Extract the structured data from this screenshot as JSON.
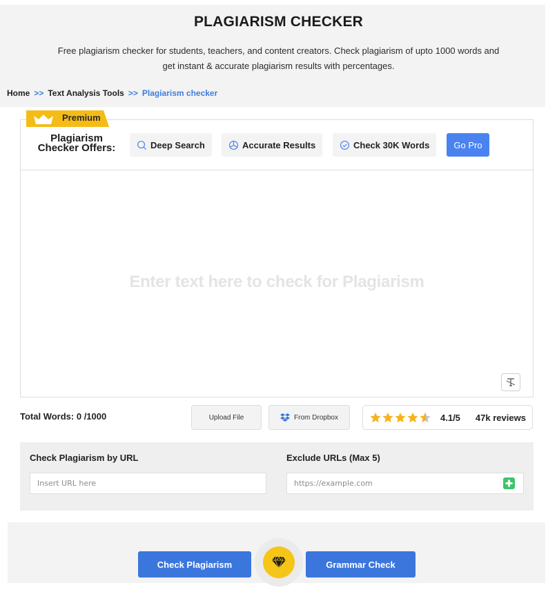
{
  "header": {
    "title": "PLAGIARISM CHECKER",
    "subtitle_line1": "Free plagiarism checker for students, teachers, and content creators. Check plagiarism of upto 1000 words and",
    "subtitle_line2": "get instant & accurate plagiarism results with percentages."
  },
  "breadcrumb": {
    "items": [
      "Home",
      "Text Analysis Tools",
      "Plagiarism checker"
    ],
    "separator": ">>"
  },
  "premium": {
    "badge_label": "Premium",
    "offers_title_line1": "Plagiarism",
    "offers_title_line2": "Checker Offers:",
    "features": [
      {
        "label": "Deep Search",
        "icon": "search-icon"
      },
      {
        "label": "Accurate Results",
        "icon": "pie-chart-icon"
      },
      {
        "label": "Check 30K Words",
        "icon": "check-circle-icon"
      }
    ],
    "go_pro_label": "Go Pro"
  },
  "editor": {
    "placeholder": "Enter text here to check for Plagiarism",
    "clear_icon": "clear-format-icon"
  },
  "toolbar": {
    "total_words_label": "Total Words: 0 /1000",
    "upload_label": "Upload File",
    "dropbox_label": "From Dropbox"
  },
  "rating": {
    "score": 4.1,
    "score_label": "4.1/5",
    "max": 5,
    "reviews_label": "47k reviews",
    "star_color": "#f5b41c"
  },
  "url_section": {
    "check_label": "Check Plagiarism by URL",
    "check_placeholder": "Insert URL here",
    "exclude_label": "Exclude URLs (Max 5)",
    "exclude_placeholder": "https://example.com"
  },
  "actions": {
    "check_label": "Check Plagiarism",
    "grammar_label": "Grammar Check",
    "premium_icon": "diamond-icon"
  },
  "colors": {
    "accent": "#3b76dd",
    "go_pro": "#4a83f0",
    "premium": "#f5bc17",
    "add": "#3dc46a"
  }
}
